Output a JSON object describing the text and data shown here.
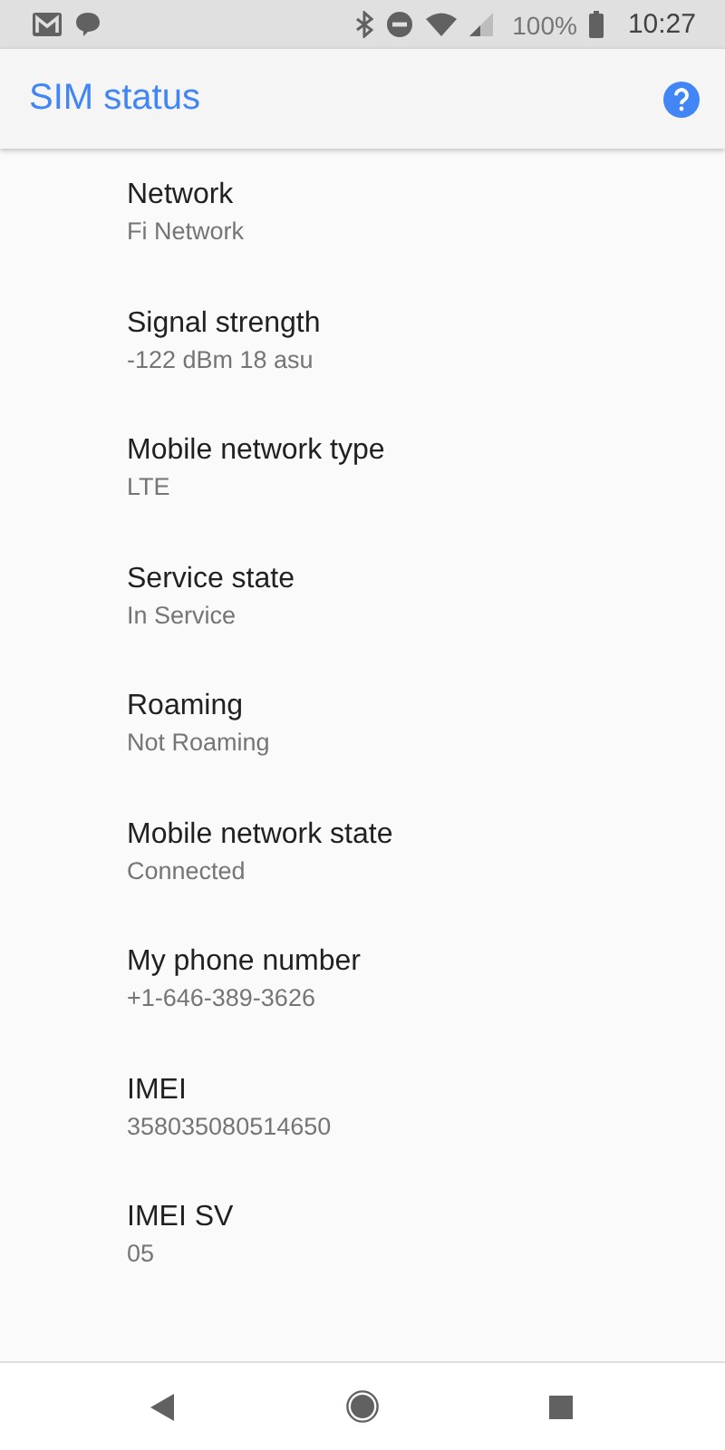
{
  "status_bar": {
    "battery": "100%",
    "time": "10:27"
  },
  "toolbar": {
    "title": "SIM status"
  },
  "items": [
    {
      "title": "Network",
      "summary": "Fi Network"
    },
    {
      "title": "Signal strength",
      "summary": "-122 dBm 18 asu"
    },
    {
      "title": "Mobile network type",
      "summary": "LTE"
    },
    {
      "title": "Service state",
      "summary": "In Service"
    },
    {
      "title": "Roaming",
      "summary": "Not Roaming"
    },
    {
      "title": "Mobile network state",
      "summary": "Connected"
    },
    {
      "title": "My phone number",
      "summary": "+1-646-389-3626"
    },
    {
      "title": "IMEI",
      "summary": "358035080514650"
    },
    {
      "title": "IMEI SV",
      "summary": "05"
    }
  ]
}
